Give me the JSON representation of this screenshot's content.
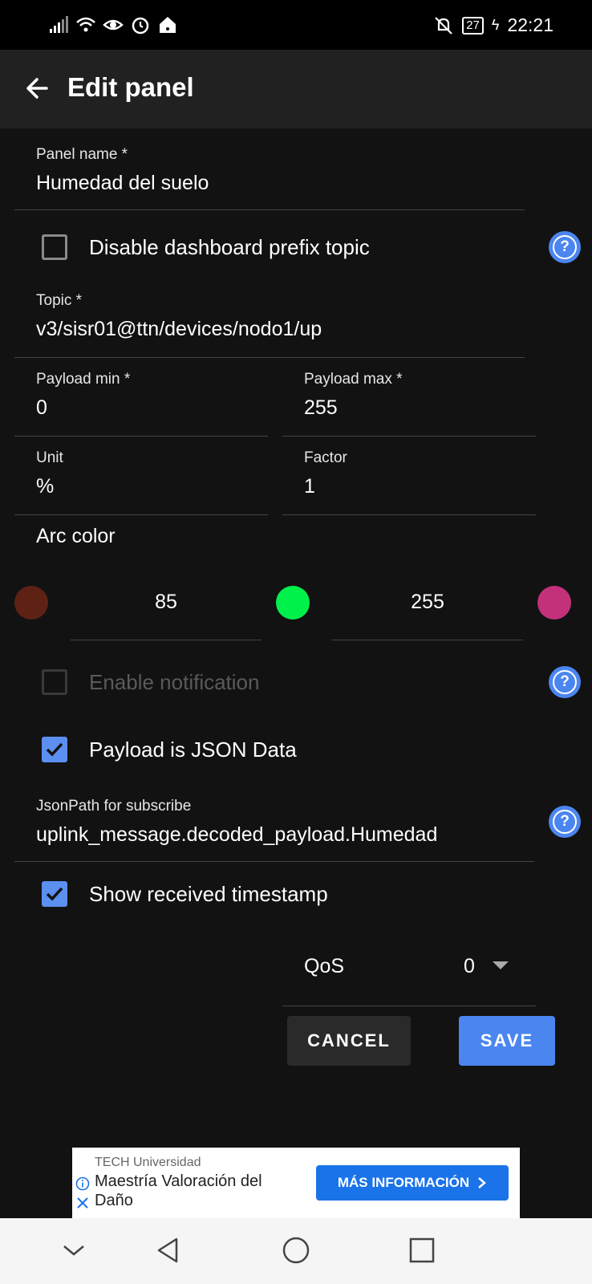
{
  "status": {
    "time": "22:21",
    "battery": "27"
  },
  "appbar": {
    "title": "Edit panel"
  },
  "form": {
    "panel_name": {
      "label": "Panel name *",
      "value": "Humedad del suelo"
    },
    "disable_prefix": {
      "label": "Disable dashboard prefix topic",
      "checked": false
    },
    "topic": {
      "label": "Topic *",
      "value": "v3/sisr01@ttn/devices/nodo1/up"
    },
    "payload_min": {
      "label": "Payload min *",
      "value": "0"
    },
    "payload_max": {
      "label": "Payload max *",
      "value": "255"
    },
    "unit": {
      "label": "Unit",
      "value": "%"
    },
    "factor": {
      "label": "Factor",
      "value": "1"
    },
    "arc_color": {
      "label": "Arc color",
      "colors": [
        "#5e2214",
        "#00f04c",
        "#c3317a"
      ],
      "thresholds": [
        "85",
        "255"
      ]
    },
    "enable_notification": {
      "label": "Enable notification",
      "checked": false,
      "disabled": true
    },
    "payload_json": {
      "label": "Payload is JSON Data",
      "checked": true
    },
    "jsonpath": {
      "label": "JsonPath for subscribe",
      "value": "uplink_message.decoded_payload.Humedad"
    },
    "show_timestamp": {
      "label": "Show received timestamp",
      "checked": true
    },
    "qos": {
      "label": "QoS",
      "value": "0"
    }
  },
  "actions": {
    "cancel": "CANCEL",
    "save": "SAVE"
  },
  "ad": {
    "brand": "TECH Universidad",
    "headline": "Maestría Valoración del Daño",
    "cta": "MÁS INFORMACIÓN"
  },
  "colors": {
    "accent": "#4b86f0",
    "background": "#121212",
    "appbar": "#212121"
  }
}
